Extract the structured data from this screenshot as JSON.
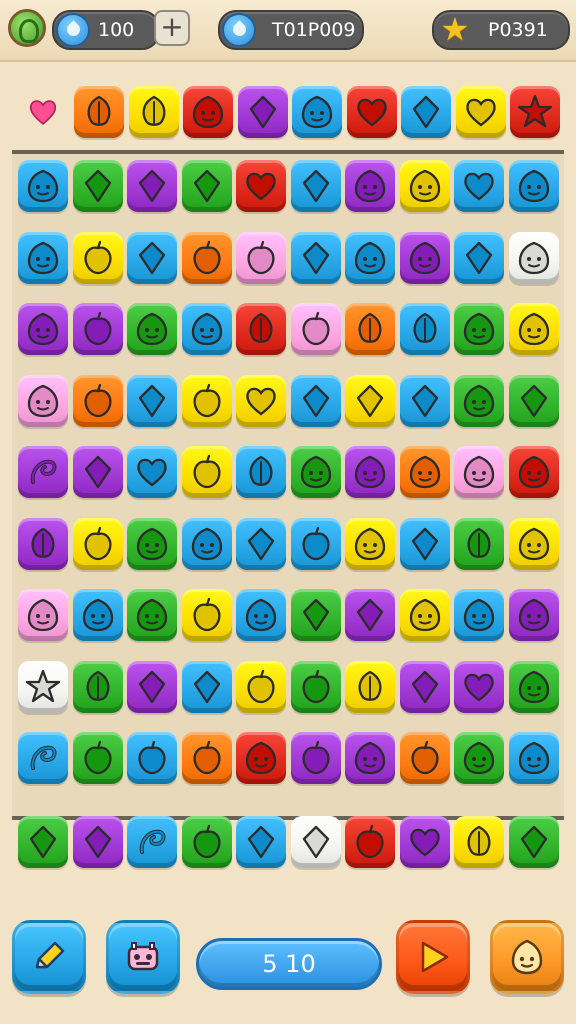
{
  "header": {
    "currency_value": "100",
    "plus_label": "+",
    "score_value": "T01P009",
    "star_value": "P0391"
  },
  "counter": {
    "label": "5 10"
  },
  "colors": {
    "green": "#33b52e",
    "red": "#e02c1f",
    "blue": "#2aa8e8",
    "yellow": "#ffe000",
    "orange": "#ff7d14",
    "purple": "#a23bd6",
    "pink": "#ffa8e4",
    "white": "#f6f6f2"
  },
  "top_row": {
    "lead_icon": "pink-heart-icon",
    "tiles": [
      {
        "color": "orange",
        "icon": "leaf"
      },
      {
        "color": "yellow",
        "icon": "leaf"
      },
      {
        "color": "red",
        "icon": "face"
      },
      {
        "color": "purple",
        "icon": "gem"
      },
      {
        "color": "blue",
        "icon": "face"
      },
      {
        "color": "red",
        "icon": "heart"
      },
      {
        "color": "blue",
        "icon": "gem"
      },
      {
        "color": "yellow",
        "icon": "heart"
      },
      {
        "color": "red",
        "icon": "star"
      }
    ]
  },
  "board": [
    [
      [
        "blue",
        "face"
      ],
      [
        "green",
        "gem"
      ],
      [
        "purple",
        "gem"
      ],
      [
        "green",
        "gem"
      ],
      [
        "red",
        "heart"
      ],
      [
        "blue",
        "gem"
      ],
      [
        "purple",
        "face"
      ],
      [
        "yellow",
        "face"
      ],
      [
        "blue",
        "heart"
      ],
      [
        "blue",
        "face"
      ]
    ],
    [
      [
        "blue",
        "face"
      ],
      [
        "yellow",
        "fruit"
      ],
      [
        "blue",
        "gem"
      ],
      [
        "orange",
        "fruit"
      ],
      [
        "pink",
        "fruit"
      ],
      [
        "blue",
        "gem"
      ],
      [
        "blue",
        "face"
      ],
      [
        "purple",
        "face"
      ],
      [
        "blue",
        "gem"
      ],
      [
        "white",
        "face"
      ]
    ],
    [
      [
        "purple",
        "face"
      ],
      [
        "purple",
        "fruit"
      ],
      [
        "green",
        "face"
      ],
      [
        "blue",
        "face"
      ],
      [
        "red",
        "leaf"
      ],
      [
        "pink",
        "fruit"
      ],
      [
        "orange",
        "leaf"
      ],
      [
        "blue",
        "leaf"
      ],
      [
        "green",
        "face"
      ],
      [
        "yellow",
        "face"
      ]
    ],
    [
      [
        "pink",
        "face"
      ],
      [
        "orange",
        "fruit"
      ],
      [
        "blue",
        "gem"
      ],
      [
        "yellow",
        "fruit"
      ],
      [
        "yellow",
        "heart"
      ],
      [
        "blue",
        "gem"
      ],
      [
        "yellow",
        "gem"
      ],
      [
        "blue",
        "gem"
      ],
      [
        "green",
        "face"
      ],
      [
        "green",
        "gem"
      ]
    ],
    [
      [
        "purple",
        "swirl"
      ],
      [
        "purple",
        "gem"
      ],
      [
        "blue",
        "heart"
      ],
      [
        "yellow",
        "fruit"
      ],
      [
        "blue",
        "leaf"
      ],
      [
        "green",
        "face"
      ],
      [
        "purple",
        "face"
      ],
      [
        "orange",
        "face"
      ],
      [
        "pink",
        "face"
      ],
      [
        "red",
        "face"
      ]
    ],
    [
      [
        "purple",
        "leaf"
      ],
      [
        "yellow",
        "fruit"
      ],
      [
        "green",
        "face"
      ],
      [
        "blue",
        "face"
      ],
      [
        "blue",
        "gem"
      ],
      [
        "blue",
        "fruit"
      ],
      [
        "yellow",
        "face"
      ],
      [
        "blue",
        "gem"
      ],
      [
        "green",
        "leaf"
      ],
      [
        "yellow",
        "face"
      ]
    ],
    [
      [
        "pink",
        "face"
      ],
      [
        "blue",
        "face"
      ],
      [
        "green",
        "face"
      ],
      [
        "yellow",
        "fruit"
      ],
      [
        "blue",
        "face"
      ],
      [
        "green",
        "gem"
      ],
      [
        "purple",
        "gem"
      ],
      [
        "yellow",
        "face"
      ],
      [
        "blue",
        "face"
      ],
      [
        "purple",
        "face"
      ]
    ],
    [
      [
        "white",
        "star"
      ],
      [
        "green",
        "leaf"
      ],
      [
        "purple",
        "gem"
      ],
      [
        "blue",
        "gem"
      ],
      [
        "yellow",
        "fruit"
      ],
      [
        "green",
        "fruit"
      ],
      [
        "yellow",
        "leaf"
      ],
      [
        "purple",
        "gem"
      ],
      [
        "purple",
        "heart"
      ],
      [
        "green",
        "face"
      ]
    ],
    [
      [
        "blue",
        "swirl"
      ],
      [
        "green",
        "fruit"
      ],
      [
        "blue",
        "fruit"
      ],
      [
        "orange",
        "fruit"
      ],
      [
        "red",
        "face"
      ],
      [
        "purple",
        "fruit"
      ],
      [
        "purple",
        "face"
      ],
      [
        "orange",
        "fruit"
      ],
      [
        "green",
        "face"
      ],
      [
        "blue",
        "face"
      ]
    ]
  ],
  "bottom_row": [
    [
      "green",
      "gem"
    ],
    [
      "purple",
      "gem"
    ],
    [
      "blue",
      "swirl"
    ],
    [
      "green",
      "fruit"
    ],
    [
      "blue",
      "gem"
    ],
    [
      "white",
      "gem"
    ],
    [
      "red",
      "fruit"
    ],
    [
      "purple",
      "heart"
    ],
    [
      "yellow",
      "leaf"
    ],
    [
      "green",
      "gem"
    ]
  ],
  "buttons": {
    "left": {
      "icon": "pencil-icon",
      "color": "#2aa8e8"
    },
    "second": {
      "icon": "robot-icon",
      "color": "#2aa8e8"
    },
    "play": {
      "icon": "play-icon",
      "color": "#ff5a1a"
    },
    "right": {
      "icon": "face-icon",
      "color": "#ff9a2a"
    }
  }
}
